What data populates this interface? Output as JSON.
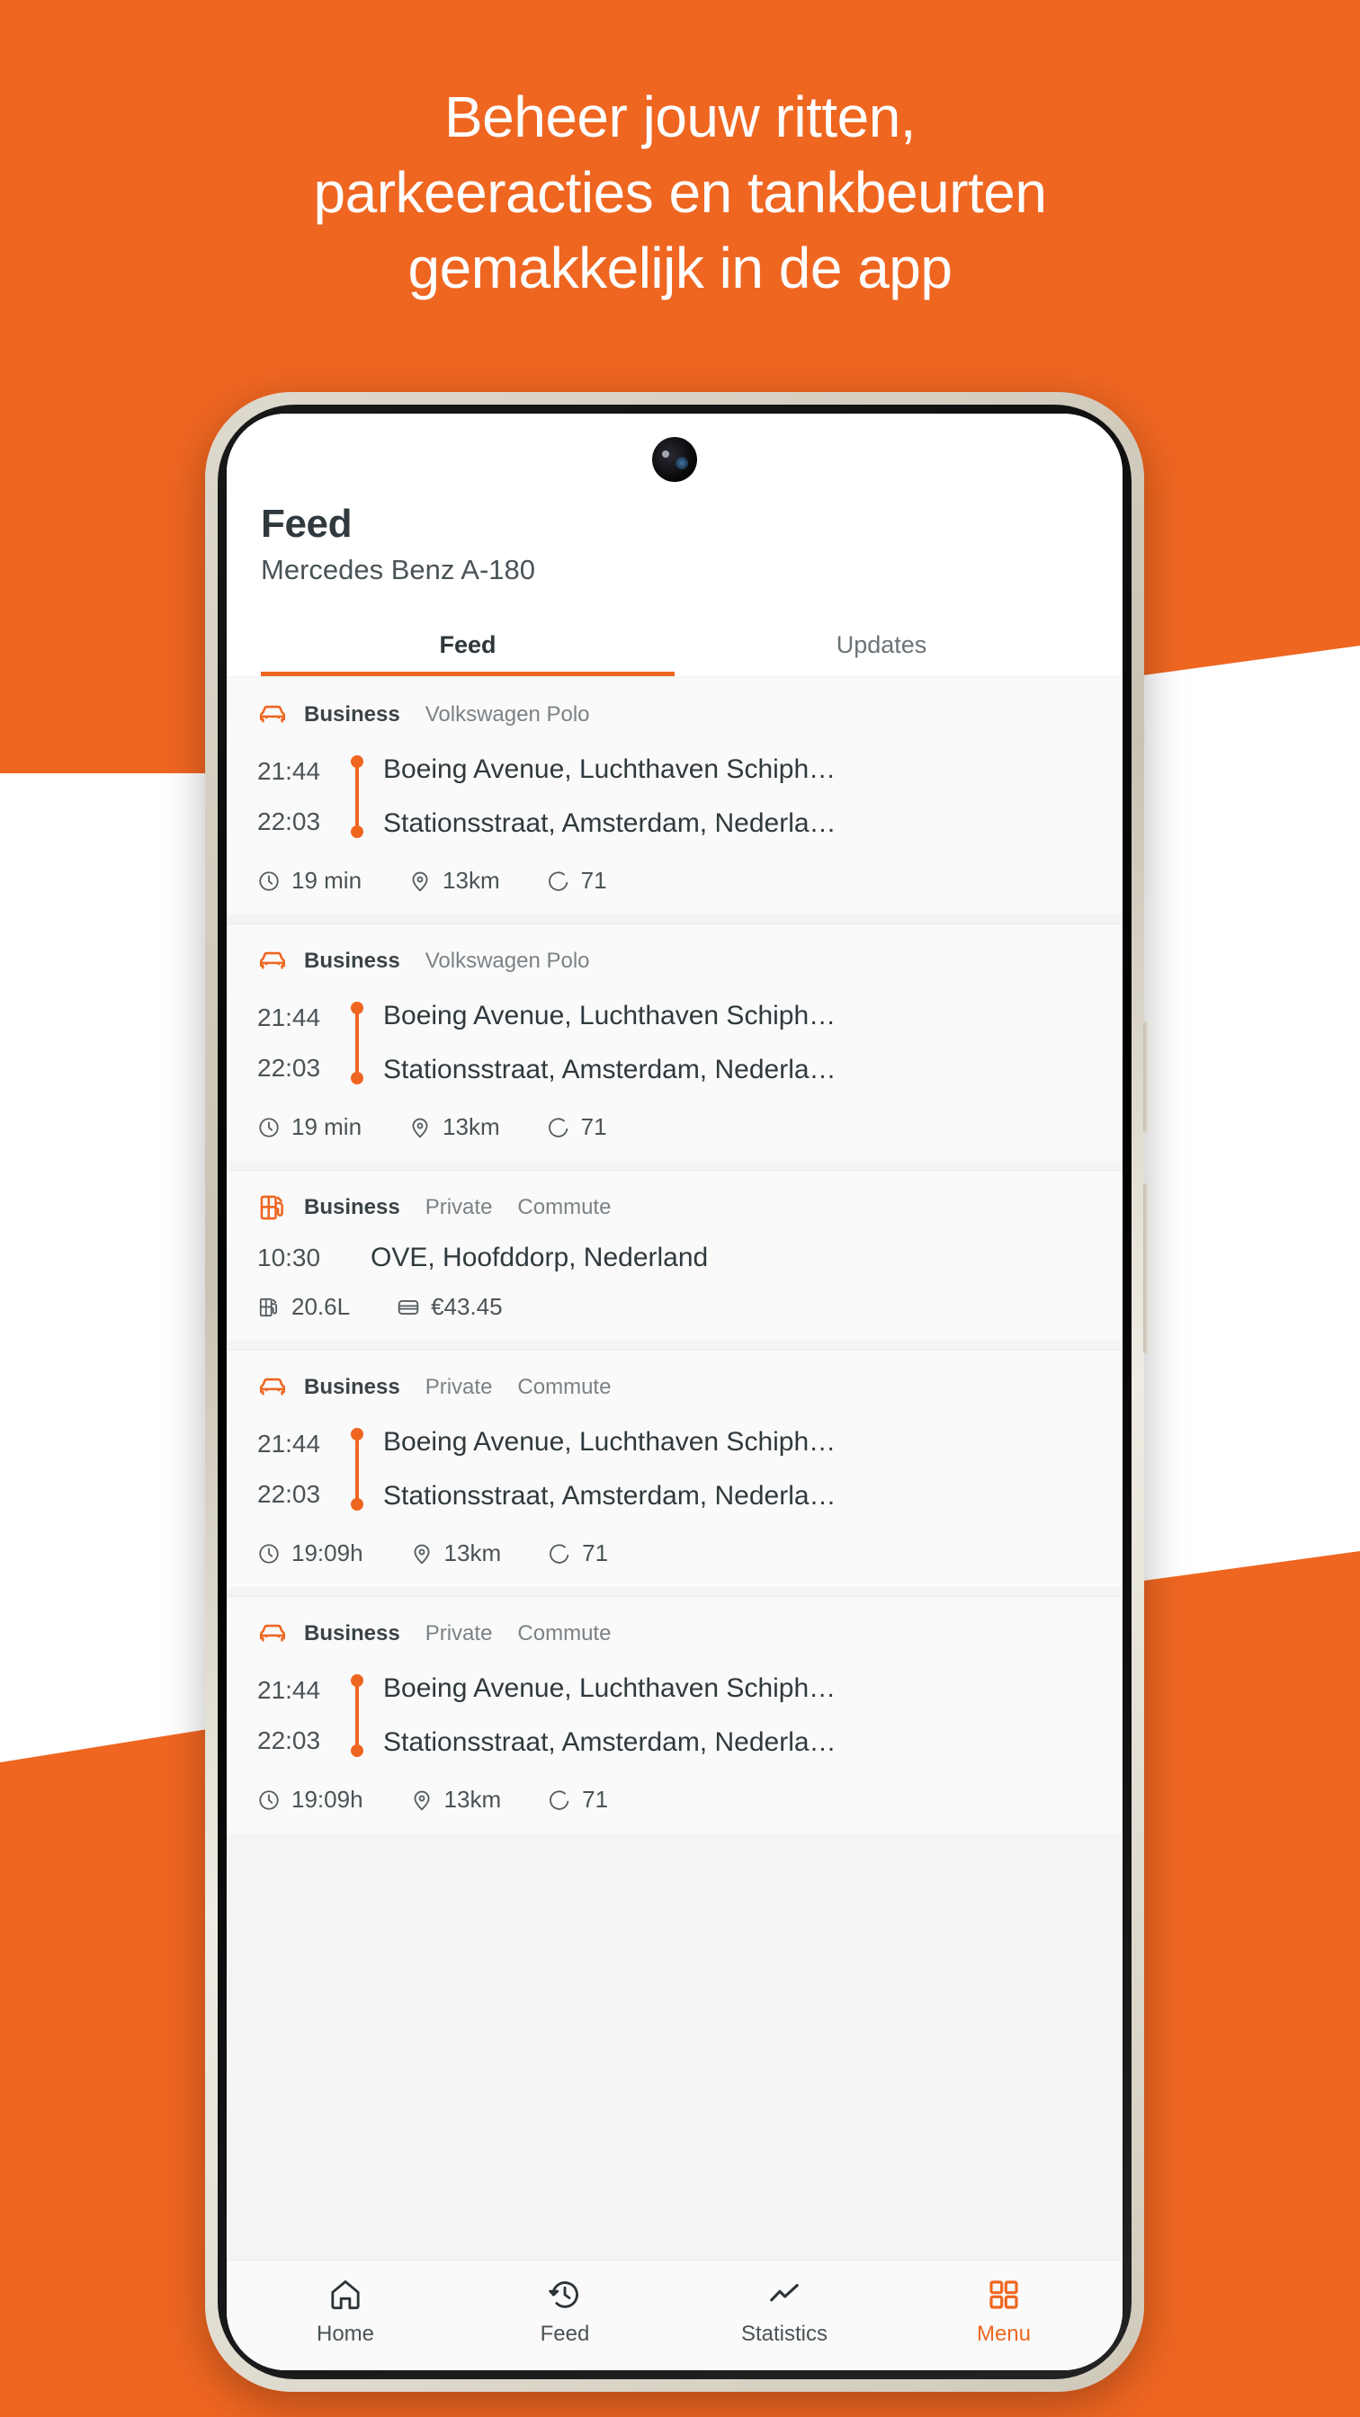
{
  "theme": {
    "brand_orange": "#ef6621",
    "bg_white": "#ffffff",
    "text_dark": "#30393d",
    "text_muted": "#7b8286"
  },
  "headline": {
    "line1": "Beheer jouw ritten,",
    "line2": "parkeeracties en tankbeurten",
    "line3": "gemakkelijk in de app"
  },
  "app": {
    "title": "Feed",
    "subtitle": "Mercedes Benz A-180",
    "tabs": [
      {
        "label": "Feed",
        "active": true
      },
      {
        "label": "Updates",
        "active": false
      }
    ],
    "cards": [
      {
        "type": "trip",
        "icon": "car-front-icon",
        "tags": [
          "Business",
          "Volkswagen Polo"
        ],
        "start_time": "21:44",
        "end_time": "22:03",
        "start_address": "Boeing Avenue, Luchthaven Schiph…",
        "end_address": "Stationsstraat, Amsterdam, Nederla…",
        "stats": [
          {
            "icon": "clock-icon",
            "value": "19 min"
          },
          {
            "icon": "map-pin-icon",
            "value": "13km"
          },
          {
            "icon": "score-gauge-icon",
            "value": "71"
          }
        ]
      },
      {
        "type": "trip",
        "icon": "car-front-icon",
        "tags": [
          "Business",
          "Volkswagen Polo"
        ],
        "start_time": "21:44",
        "end_time": "22:03",
        "start_address": "Boeing Avenue, Luchthaven Schiph…",
        "end_address": "Stationsstraat, Amsterdam, Nederla…",
        "stats": [
          {
            "icon": "clock-icon",
            "value": "19 min"
          },
          {
            "icon": "map-pin-icon",
            "value": "13km"
          },
          {
            "icon": "score-gauge-icon",
            "value": "71"
          }
        ]
      },
      {
        "type": "fuel",
        "icon": "fuel-pump-icon",
        "tags": [
          "Business",
          "Private",
          "Commute"
        ],
        "time": "10:30",
        "address": "OVE, Hoofddorp, Nederland",
        "stats": [
          {
            "icon": "fuel-pump-icon",
            "value": "20.6L"
          },
          {
            "icon": "credit-card-icon",
            "value": "€43.45"
          }
        ]
      },
      {
        "type": "trip",
        "icon": "car-front-icon",
        "tags": [
          "Business",
          "Private",
          "Commute"
        ],
        "start_time": "21:44",
        "end_time": "22:03",
        "start_address": "Boeing Avenue, Luchthaven Schiph…",
        "end_address": "Stationsstraat, Amsterdam, Nederla…",
        "stats": [
          {
            "icon": "clock-icon",
            "value": "19:09h"
          },
          {
            "icon": "map-pin-icon",
            "value": "13km"
          },
          {
            "icon": "score-gauge-icon",
            "value": "71"
          }
        ]
      },
      {
        "type": "trip",
        "icon": "car-front-icon",
        "tags": [
          "Business",
          "Private",
          "Commute"
        ],
        "start_time": "21:44",
        "end_time": "22:03",
        "start_address": "Boeing Avenue, Luchthaven Schiph…",
        "end_address": "Stationsstraat, Amsterdam, Nederla…",
        "stats": [
          {
            "icon": "clock-icon",
            "value": "19:09h"
          },
          {
            "icon": "map-pin-icon",
            "value": "13km"
          },
          {
            "icon": "score-gauge-icon",
            "value": "71"
          }
        ]
      }
    ],
    "bottom_nav": [
      {
        "label": "Home",
        "icon": "home-icon",
        "active": false
      },
      {
        "label": "Feed",
        "icon": "history-clock-icon",
        "active": false
      },
      {
        "label": "Statistics",
        "icon": "line-chart-icon",
        "active": false
      },
      {
        "label": "Menu",
        "icon": "grid-menu-icon",
        "active": true
      }
    ]
  }
}
